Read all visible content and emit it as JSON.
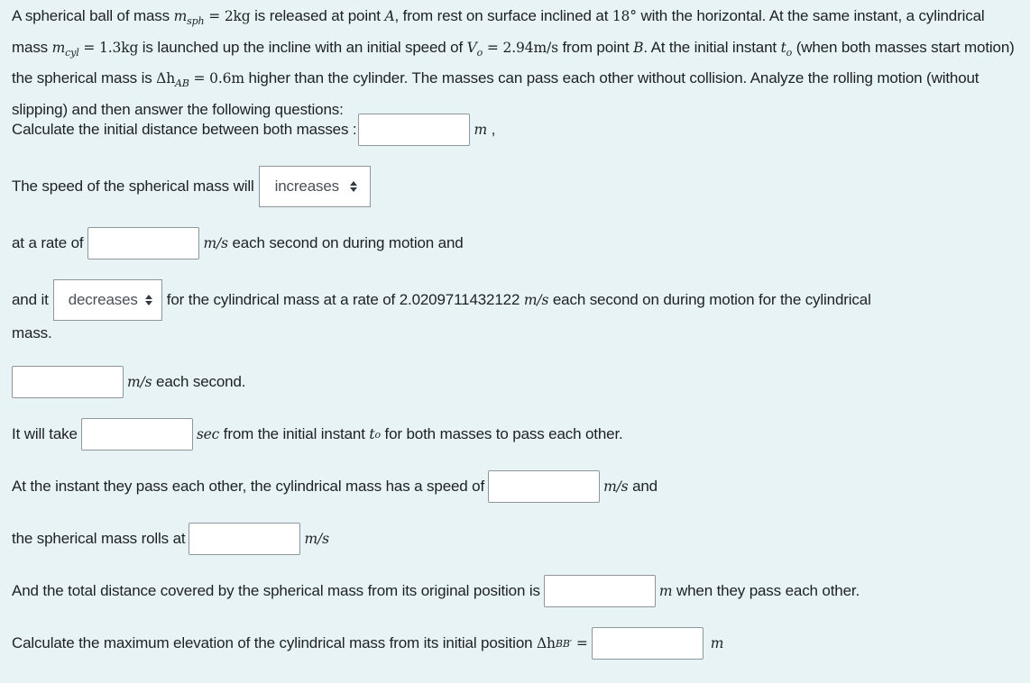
{
  "intro": {
    "p1": "A spherical ball of mass ",
    "m_sph_sym": "m",
    "m_sph_sub": "sph",
    "m_sph_val": " = 2kg",
    "p2": " is released at point ",
    "pointA": "A",
    "p3": ", from rest on surface inclined at ",
    "angle": "18°",
    "p4": " with the horizontal. At the same instant, a cylindrical mass ",
    "m_cyl_sym": "m",
    "m_cyl_sub": "cyl",
    "m_cyl_val": " = 1.3kg",
    "p5": " is launched up the incline with an initial speed of ",
    "v0_sym": "V",
    "v0_sub": "o",
    "v0_val": " = 2.94m/s",
    "p6": " from point ",
    "pointB": "B",
    "p7": ". At the initial instant ",
    "t0_sym": "t",
    "t0_sub": "o",
    "p8": " (when both masses start motion) the spherical mass is ",
    "dh_sym": "Δh",
    "dh_sub": "AB",
    "dh_val": " = 0.6m",
    "p9": " higher than the cylinder. The masses can pass each other without collision. Analyze the rolling motion (without slipping) and then answer the following questions:"
  },
  "q1": {
    "label": "Calculate the initial distance between both masses :",
    "unit": "m",
    "after": " ,"
  },
  "q2": {
    "label": "The speed of the spherical mass will",
    "selected": "increases"
  },
  "q3": {
    "label": "at a rate of",
    "unit": "m/s",
    "after": " each second on during motion and"
  },
  "q4": {
    "label": "and it",
    "selected": "decreases",
    "after_pre": "for the cylindrical mass at a rate of 2.0209711432122 ",
    "unit": "m/s",
    "after_post": " each second on during motion for the cylindrical",
    "wrap": "mass."
  },
  "q5": {
    "unit": "m/s",
    "after": " each second."
  },
  "q6": {
    "label": "It will take",
    "unit": "sec",
    "after_pre": " from the initial instant ",
    "t0_sym": "t",
    "t0_sub": "o",
    "after_post": " for both masses to pass each other."
  },
  "q7": {
    "label": "At the instant they pass each other, the cylindrical mass has a speed of",
    "unit": "m/s",
    "after": " and"
  },
  "q8": {
    "label": "the spherical mass rolls at",
    "unit": "m/s"
  },
  "q9": {
    "label": "And the total distance covered by the spherical mass from its original position is",
    "unit": "m",
    "after": " when they pass each other."
  },
  "q10": {
    "label": "Calculate the maximum elevation of the cylindrical mass from its initial position ",
    "sym": "Δh",
    "sub": "BB′",
    "eq": " =",
    "unit": "m"
  }
}
